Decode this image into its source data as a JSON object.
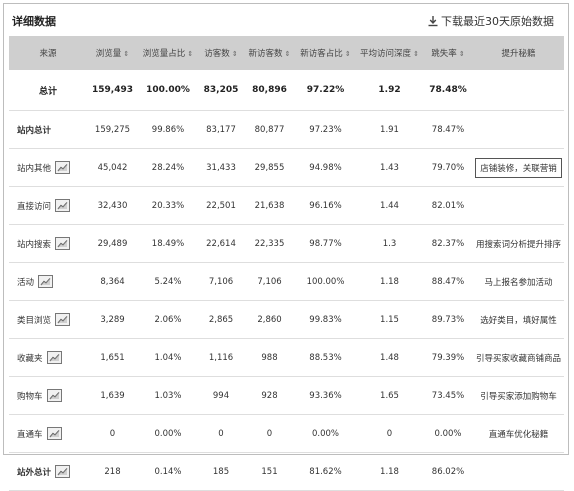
{
  "header": {
    "title": "详细数据",
    "download_label": "下载最近30天原始数据"
  },
  "columns": [
    "来源",
    "浏览量",
    "浏览量占比",
    "访客数",
    "新访客数",
    "新访客占比",
    "平均访问深度",
    "跳失率",
    "提升秘籍"
  ],
  "total": {
    "source": "总计",
    "pv": "159,493",
    "pv_ratio": "100.00%",
    "uv": "83,205",
    "new_uv": "80,896",
    "new_ratio": "97.22%",
    "depth": "1.92",
    "bounce": "78.48%",
    "tip": ""
  },
  "rows": [
    {
      "source": "站内总计",
      "pv": "159,275",
      "pv_ratio": "99.86%",
      "uv": "83,177",
      "new_uv": "80,877",
      "new_ratio": "97.23%",
      "depth": "1.91",
      "bounce": "78.47%",
      "tip": ""
    },
    {
      "source": "站内其他",
      "pv": "45,042",
      "pv_ratio": "28.24%",
      "uv": "31,433",
      "new_uv": "29,855",
      "new_ratio": "94.98%",
      "depth": "1.43",
      "bounce": "79.70%",
      "tip": "店铺装修，关联营销"
    },
    {
      "source": "直接访问",
      "pv": "32,430",
      "pv_ratio": "20.33%",
      "uv": "22,501",
      "new_uv": "21,638",
      "new_ratio": "96.16%",
      "depth": "1.44",
      "bounce": "82.01%",
      "tip": ""
    },
    {
      "source": "站内搜索",
      "pv": "29,489",
      "pv_ratio": "18.49%",
      "uv": "22,614",
      "new_uv": "22,335",
      "new_ratio": "98.77%",
      "depth": "1.3",
      "bounce": "82.37%",
      "tip": "用搜索词分析提升排序"
    },
    {
      "source": "活动",
      "pv": "8,364",
      "pv_ratio": "5.24%",
      "uv": "7,106",
      "new_uv": "7,106",
      "new_ratio": "100.00%",
      "depth": "1.18",
      "bounce": "88.47%",
      "tip": "马上报名参加活动"
    },
    {
      "source": "类目浏览",
      "pv": "3,289",
      "pv_ratio": "2.06%",
      "uv": "2,865",
      "new_uv": "2,860",
      "new_ratio": "99.83%",
      "depth": "1.15",
      "bounce": "89.73%",
      "tip": "选好类目，填好属性"
    },
    {
      "source": "收藏夹",
      "pv": "1,651",
      "pv_ratio": "1.04%",
      "uv": "1,116",
      "new_uv": "988",
      "new_ratio": "88.53%",
      "depth": "1.48",
      "bounce": "79.39%",
      "tip": "引导买家收藏商铺商品"
    },
    {
      "source": "购物车",
      "pv": "1,639",
      "pv_ratio": "1.03%",
      "uv": "994",
      "new_uv": "928",
      "new_ratio": "93.36%",
      "depth": "1.65",
      "bounce": "73.45%",
      "tip": "引导买家添加购物车"
    },
    {
      "source": "直通车",
      "pv": "0",
      "pv_ratio": "0.00%",
      "uv": "0",
      "new_uv": "0",
      "new_ratio": "0.00%",
      "depth": "0",
      "bounce": "0.00%",
      "tip": "直通车优化秘籍"
    },
    {
      "source": "站外总计",
      "pv": "218",
      "pv_ratio": "0.14%",
      "uv": "185",
      "new_uv": "151",
      "new_ratio": "81.62%",
      "depth": "1.18",
      "bounce": "86.02%",
      "tip": ""
    }
  ]
}
